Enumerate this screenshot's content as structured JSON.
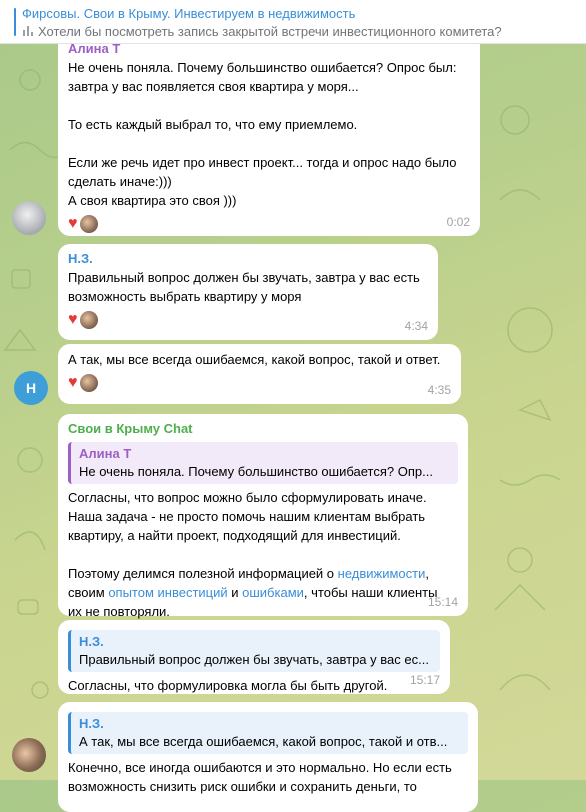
{
  "pinned": {
    "title": "Фирсовы. Свои в Крыму. Инвестируем в недвижимость",
    "subtitle": "Хотели бы посмотреть запись закрытой встречи инвестиционного комитета?"
  },
  "messages": [
    {
      "sender": "Алина Т",
      "text": "Не очень поняла. Почему большинство ошибается? Опрос был:\nзавтра у вас появляется своя квартира у моря...\n\nТо есть каждый выбрал то, что ему приемлемо.\n\nЕсли же речь идет про инвест проект... тогда и опрос надо было\nсделать иначе:)))\nА своя квартира это своя )))",
      "time": "0:02"
    },
    {
      "sender": "Н.З.",
      "text": "Правильный вопрос должен бы звучать, завтра у вас есть\nвозможность выбрать квартиру у моря",
      "time": "4:34"
    },
    {
      "text": "А так, мы все всегда ошибаемся, какой вопрос, такой и ответ.",
      "time": "4:35",
      "avatar_letter": "Н"
    },
    {
      "sender": "Свои в Крыму Chat",
      "reply_name": "Алина Т",
      "reply_text": "Не очень поняла. Почему большинство ошибается? Опр...",
      "text_1": "Согласны, что вопрос можно было сформулировать иначе.\nНаша задача - не просто помочь нашим клиентам выбрать\nквартиру, а найти проект, подходящий для инвестиций.\n\nПоэтому делимся полезной информацией о ",
      "link_1": "недвижимости",
      "text_2": ",\nсвоим ",
      "link_2": "опытом инвестиций",
      "text_3": " и ",
      "link_3": "ошибками",
      "text_4": ", чтобы наши клиенты\nих не повторяли.",
      "time": "15:14"
    },
    {
      "reply_name": "Н.З.",
      "reply_text": "Правильный вопрос должен бы звучать, завтра у вас ес...",
      "text": "Согласны, что формулировка могла бы быть другой.",
      "time": "15:17"
    },
    {
      "reply_name": "Н.З.",
      "reply_text": "А так, мы все всегда ошибаемся, какой вопрос, такой и отв...",
      "text": "Конечно, все иногда ошибаются и это нормально. Но если есть\nвозможность снизить риск ошибки и сохранить деньги, то"
    }
  ]
}
